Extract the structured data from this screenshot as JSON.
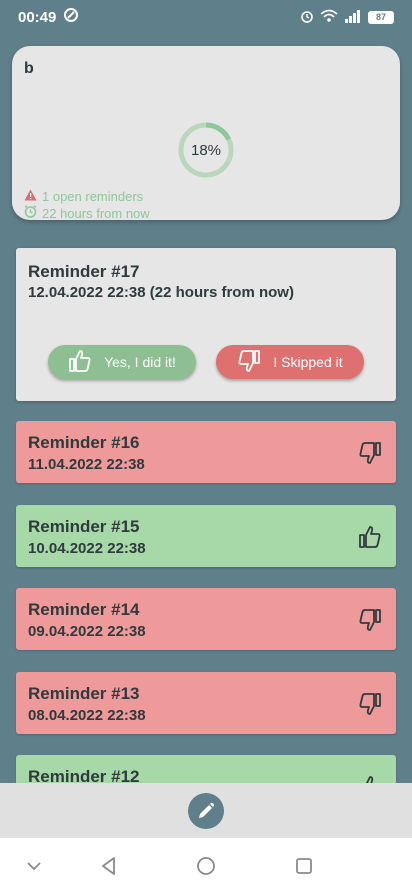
{
  "status_bar": {
    "time": "00:49",
    "battery": "87"
  },
  "summary": {
    "title": "b",
    "progress_label": "18%",
    "progress_fraction": 0.18,
    "open_reminders": "1 open reminders",
    "next_time": "22 hours from now"
  },
  "current": {
    "title": "Reminder #17",
    "date": "12.04.2022 22:38 (22 hours from now)",
    "yes_label": "Yes, I did it!",
    "skip_label": "I Skipped it"
  },
  "reminders": [
    {
      "title": "Reminder #16",
      "date": "11.04.2022 22:38",
      "status": "skipped"
    },
    {
      "title": "Reminder #15",
      "date": "10.04.2022 22:38",
      "status": "done"
    },
    {
      "title": "Reminder #14",
      "date": "09.04.2022 22:38",
      "status": "skipped"
    },
    {
      "title": "Reminder #13",
      "date": "08.04.2022 22:38",
      "status": "skipped"
    },
    {
      "title": "Reminder #12",
      "date": "",
      "status": "done"
    }
  ],
  "colors": {
    "background": "#5f7f8b",
    "done": "#a6d8a8",
    "skipped": "#ef9a9a",
    "yes_button": "#8dbf93",
    "skip_button": "#df7070",
    "accent_green": "#8ec79a"
  },
  "icons": {
    "yes": "thumb-up-icon",
    "skip": "thumb-down-icon",
    "fab": "pencil-icon",
    "warning": "warning-icon",
    "alarm": "alarm-icon"
  }
}
